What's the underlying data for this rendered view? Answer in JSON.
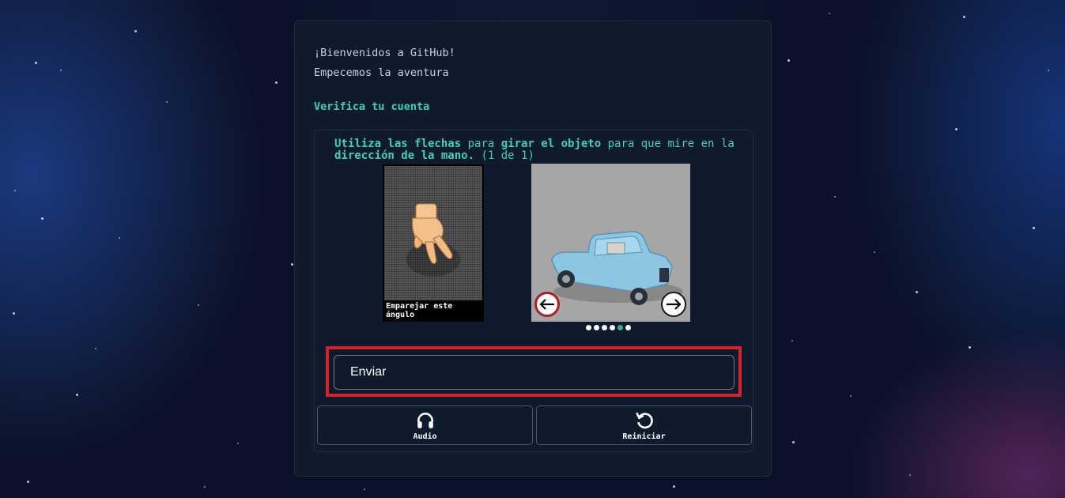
{
  "welcome": {
    "line1": "¡Bienvenidos a GitHub!",
    "line2": "Empecemos la aventura"
  },
  "verify": {
    "title": "Verifica tu cuenta"
  },
  "puzzle": {
    "instruction_parts": [
      "Utiliza las flechas",
      " para ",
      "girar el objeto",
      " para que mire en la ",
      "dirección de la mano.",
      " (1 de 1)"
    ],
    "reference_label": "Emparejar este ángulo",
    "left_arrow_icon": "arrow-left-icon",
    "right_arrow_icon": "arrow-right-icon",
    "dots": [
      false,
      false,
      false,
      false,
      true,
      false
    ]
  },
  "submit": {
    "label": "Enviar"
  },
  "tools": {
    "audio": {
      "label": "Audio",
      "icon": "headphones-icon"
    },
    "restart": {
      "label": "Reiniciar",
      "icon": "restart-icon"
    }
  },
  "colors": {
    "accent": "#3fd1b5",
    "highlight": "#d1242f",
    "active_dot": "#3fae7a",
    "card_bg": "#0f1b2c"
  }
}
